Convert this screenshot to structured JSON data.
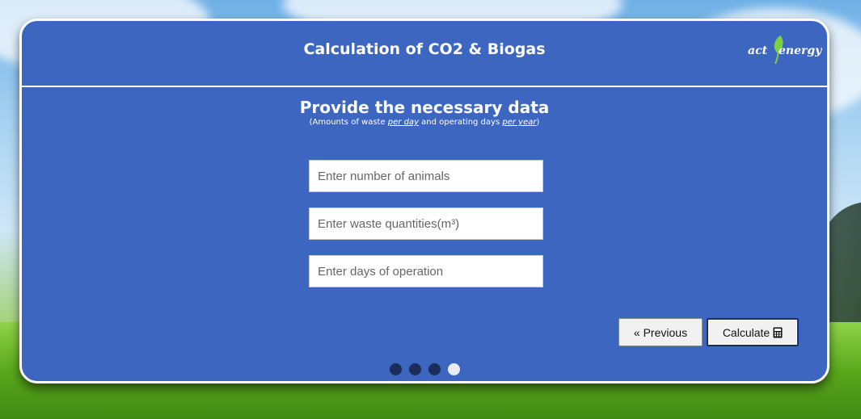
{
  "header": {
    "title": "Calculation of CO2 & Biogas"
  },
  "logo": {
    "part1": "act",
    "part2": "energy",
    "leaf_color": "#7ad143"
  },
  "form": {
    "heading": "Provide the necessary data",
    "note_prefix": "(Amounts of waste ",
    "note_u1": "per day",
    "note_mid": " and operating days ",
    "note_u2": "per year",
    "note_suffix": ")",
    "fields": {
      "animals": {
        "placeholder": "Enter number of animals",
        "value": ""
      },
      "waste": {
        "placeholder": "Enter waste quantities(m³)",
        "value": ""
      },
      "days": {
        "placeholder": "Enter days of operation",
        "value": ""
      }
    }
  },
  "buttons": {
    "previous_label": "« Previous",
    "calculate_label": "Calculate",
    "calculate_icon": "calculator-icon"
  },
  "steps": {
    "total": 4,
    "current": 4
  },
  "colors": {
    "card": "#3d66c0",
    "dot": "#1b2d59",
    "dot_active": "#e9ecf3"
  }
}
